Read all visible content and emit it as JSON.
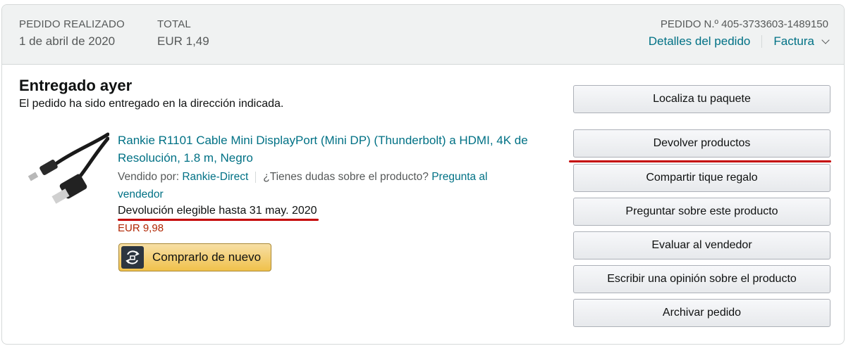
{
  "header": {
    "placed_label": "PEDIDO REALIZADO",
    "placed_date": "1 de abril de 2020",
    "total_label": "TOTAL",
    "total_value": "EUR 1,49",
    "order_number": "PEDIDO N.º 405-3733603-1489150",
    "details_link": "Detalles del pedido",
    "invoice_link": "Factura"
  },
  "shipment": {
    "status": "Entregado ayer",
    "substatus": "El pedido ha sido entregado en la dirección indicada."
  },
  "product": {
    "title": "Rankie R1101 Cable Mini DisplayPort (Mini DP) (Thunderbolt) a HDMI, 4K de Resolución, 1.8 m, Negro",
    "sold_by_label": "Vendido por:",
    "seller_name": "Rankie-Direct",
    "question_text": "¿Tienes dudas sobre el producto?",
    "ask_seller_link": "Pregunta al vendedor",
    "return_eligibility": "Devolución elegible hasta 31 may. 2020",
    "price": "EUR 9,98",
    "buy_again_label": "Comprarlo de nuevo"
  },
  "actions": [
    "Localiza tu paquete",
    "Devolver productos",
    "Compartir tique regalo",
    "Preguntar sobre este producto",
    "Evaluar al vendedor",
    "Escribir una opinión sobre el producto",
    "Archivar pedido"
  ],
  "colors": {
    "link": "#007185",
    "price": "#b12704",
    "annotation_red": "#c40000",
    "buy_button": "#f0c14b"
  }
}
